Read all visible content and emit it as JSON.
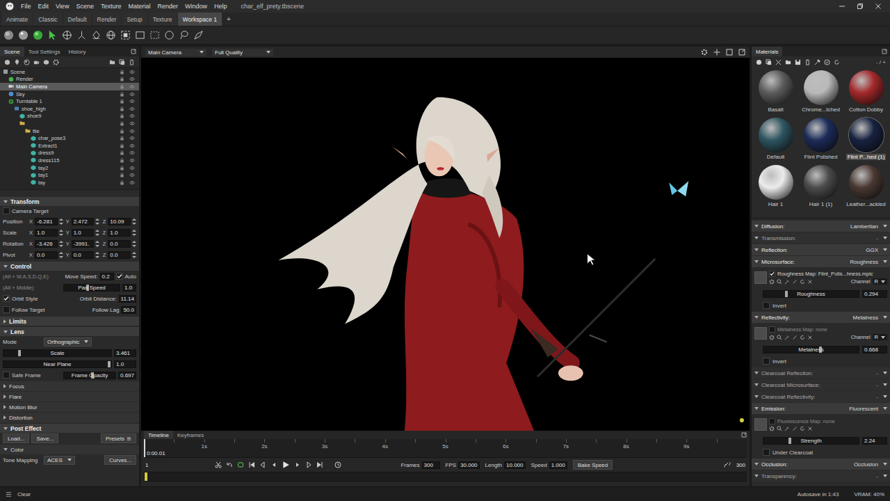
{
  "window": {
    "title": "char_elf_prety.tbscene"
  },
  "menu": [
    "File",
    "Edit",
    "View",
    "Scene",
    "Texture",
    "Material",
    "Render",
    "Window",
    "Help"
  ],
  "workspace_tabs": [
    {
      "label": "Animate",
      "selected": false
    },
    {
      "label": "Classic",
      "selected": false
    },
    {
      "label": "Default",
      "selected": false
    },
    {
      "label": "Render",
      "selected": false
    },
    {
      "label": "Setup",
      "selected": false
    },
    {
      "label": "Texture",
      "selected": false
    },
    {
      "label": "Workspace 1",
      "selected": true
    }
  ],
  "add_tab": "+",
  "left_panel": {
    "tabs": [
      {
        "label": "Scene",
        "selected": true
      },
      {
        "label": "Tool Settings",
        "selected": false
      },
      {
        "label": "History",
        "selected": false
      }
    ],
    "tree": [
      {
        "label": "Scene",
        "depth": 0,
        "kind": "scene",
        "selected": false
      },
      {
        "label": "Render",
        "depth": 1,
        "kind": "render",
        "selected": false
      },
      {
        "label": "Main Camera",
        "depth": 1,
        "kind": "camera",
        "selected": true
      },
      {
        "label": "Sky",
        "depth": 1,
        "kind": "sky",
        "selected": false
      },
      {
        "label": "Turntable 1",
        "depth": 1,
        "kind": "turntable",
        "selected": false
      },
      {
        "label": "shoe_high",
        "depth": 2,
        "kind": "group",
        "selected": false
      },
      {
        "label": "shoe9",
        "depth": 3,
        "kind": "mesh",
        "selected": false
      },
      {
        "label": "",
        "depth": 3,
        "kind": "folder",
        "selected": false
      },
      {
        "label": "file",
        "depth": 4,
        "kind": "folder",
        "selected": false
      },
      {
        "label": "char_pose3",
        "depth": 5,
        "kind": "mesh",
        "selected": false
      },
      {
        "label": "Extract1",
        "depth": 5,
        "kind": "mesh",
        "selected": false
      },
      {
        "label": "dress9",
        "depth": 5,
        "kind": "mesh",
        "selected": false
      },
      {
        "label": "dress115",
        "depth": 5,
        "kind": "mesh",
        "selected": false
      },
      {
        "label": "tay2",
        "depth": 5,
        "kind": "mesh",
        "selected": false
      },
      {
        "label": "tay1",
        "depth": 5,
        "kind": "mesh",
        "selected": false
      },
      {
        "label": "tay",
        "depth": 5,
        "kind": "mesh",
        "selected": false
      }
    ]
  },
  "transform": {
    "title": "Transform",
    "expanded": true,
    "camera_target": {
      "label": "Camera Target",
      "checked": false
    },
    "rows": [
      {
        "label": "Position",
        "values": [
          {
            "axis": "X",
            "value": "-6.281"
          },
          {
            "axis": "Y",
            "value": "2.472"
          },
          {
            "axis": "Z",
            "value": "10.09"
          }
        ]
      },
      {
        "label": "Scale",
        "values": [
          {
            "axis": "X",
            "value": "1.0"
          },
          {
            "axis": "Y",
            "value": "1.0"
          },
          {
            "axis": "Z",
            "value": "1.0"
          }
        ]
      },
      {
        "label": "Rotation",
        "values": [
          {
            "axis": "X",
            "value": "-3.426"
          },
          {
            "axis": "Y",
            "value": "-3991."
          },
          {
            "axis": "Z",
            "value": "0.0"
          }
        ]
      },
      {
        "label": "Pivot",
        "values": [
          {
            "axis": "X",
            "value": "0.0"
          },
          {
            "axis": "Y",
            "value": "0.0"
          },
          {
            "axis": "Z",
            "value": "0.0"
          }
        ]
      }
    ]
  },
  "control": {
    "title": "Control",
    "expanded": true,
    "rows": [
      {
        "left": {
          "kind": "hint",
          "text": "(Alt + W,A,S,D,Q,E)"
        },
        "right": {
          "kind": "field",
          "label": "Move Speed:",
          "value": "0.2",
          "option": {
            "label": "Auto",
            "checked": true
          }
        }
      },
      {
        "left": {
          "kind": "hint",
          "text": "(Alt + Middle)"
        },
        "right": {
          "kind": "slider",
          "label": "Pan Speed",
          "value": "1.0",
          "level": 0.43
        }
      },
      {
        "left": {
          "kind": "check",
          "label": "Orbit Style",
          "checked": true
        },
        "right": {
          "kind": "field",
          "label": "Orbit Distance:",
          "value": "11.14"
        }
      },
      {
        "left": {
          "kind": "check",
          "label": "Follow Target",
          "checked": false
        },
        "right": {
          "kind": "field",
          "label": "Follow Lag",
          "value": "50.0"
        }
      }
    ]
  },
  "limits": {
    "title": "Limits",
    "expanded": false
  },
  "lens": {
    "title": "Lens",
    "expanded": true,
    "mode": {
      "label": "Mode",
      "value": "Orthographic"
    },
    "sliders": [
      {
        "label": "Scale",
        "value": "3.461",
        "level": 0.15
      },
      {
        "label": "Near Plane",
        "value": "1.0",
        "level": 0.98
      }
    ],
    "rows": [
      {
        "left": {
          "kind": "check",
          "label": "Safe Frame",
          "checked": false
        },
        "right": {
          "kind": "slider",
          "label": "Frame Opacity",
          "value": "0.697",
          "level": 0.55
        }
      }
    ],
    "subsections": [
      {
        "title": "Focus",
        "expanded": false
      },
      {
        "title": "Flare",
        "expanded": false
      },
      {
        "title": "Motion Blur",
        "expanded": false
      },
      {
        "title": "Distortion",
        "expanded": false
      }
    ]
  },
  "post_effect": {
    "title": "Post Effect",
    "expanded": true,
    "buttons": [
      "Load...",
      "Save..."
    ],
    "presets": "Presets",
    "color": {
      "title": "Color",
      "expanded": true,
      "tone_mapping": {
        "label": "Tone Mapping",
        "value": "ACES"
      },
      "curves": "Curves..."
    }
  },
  "viewport": {
    "camera": "Main Camera",
    "quality": "Full Quality"
  },
  "timeline": {
    "tabs": [
      {
        "label": "Timeline",
        "selected": true
      },
      {
        "label": "Keyframes",
        "selected": false
      }
    ],
    "ruler": [
      "1s",
      "2s",
      "3s",
      "4s",
      "5s",
      "6s",
      "7s",
      "8s",
      "9s"
    ],
    "current_time": "0:00.01",
    "playhead": 0,
    "start_frame": "1",
    "fields": [
      {
        "label": "Frames",
        "value": "300"
      },
      {
        "label": "FPS",
        "value": "30.000"
      },
      {
        "label": "Length",
        "value": "10.000"
      },
      {
        "label": "Speed",
        "value": "1.000"
      }
    ],
    "bake_button": "Bake Speed",
    "end_frame": "300"
  },
  "materials": {
    "title": "Materials",
    "zoom": "- / +",
    "items": [
      {
        "name": "Basalt",
        "color": "#5b5b5b",
        "selected": false
      },
      {
        "name": "Chrome...tched",
        "color": "#b9b9b9",
        "selected": false
      },
      {
        "name": "Cotton Dobby",
        "color": "#a3282a",
        "selected": false
      },
      {
        "name": "Default",
        "color": "#2e5561",
        "selected": false
      },
      {
        "name": "Flint Polished",
        "color": "#1c2b58",
        "selected": false
      },
      {
        "name": "Flint P...hed (1)",
        "color": "#17223f",
        "selected": true
      },
      {
        "name": "Hair 1",
        "color": "#ececec",
        "selected": false
      },
      {
        "name": "Hair 1 (1)",
        "color": "#4b4b4b",
        "selected": false
      },
      {
        "name": "Leather...ackled",
        "color": "#4a3932",
        "selected": false
      }
    ]
  },
  "material_properties": [
    {
      "kind": "section",
      "label": "Diffusion:",
      "value": "Lambertian"
    },
    {
      "kind": "sub",
      "label": "Transmission:",
      "value": "-"
    },
    {
      "kind": "section",
      "label": "Reflection:",
      "value": "GGX"
    },
    {
      "kind": "section",
      "label": "Microsurface:",
      "value": "Roughness"
    },
    {
      "kind": "map",
      "label": "Roughness Map: Flint_Polis...hness.mpic",
      "enabled": true,
      "channel_label": "Channel",
      "channel": "R"
    },
    {
      "kind": "slider",
      "label": "Roughness",
      "value": "0.294",
      "level": 0.24
    },
    {
      "kind": "check",
      "label": "Invert",
      "checked": false
    },
    {
      "kind": "section",
      "label": "Reflectivity:",
      "value": "Metalness"
    },
    {
      "kind": "map",
      "label": "Metalness Map: none",
      "enabled": false,
      "channel_label": "Channel",
      "channel": "R"
    },
    {
      "kind": "slider",
      "label": "Metalness",
      "value": "0.668",
      "level": 0.6
    },
    {
      "kind": "check",
      "label": "Invert",
      "checked": false
    },
    {
      "kind": "sub",
      "label": "Clearcoat Reflection:",
      "value": "-"
    },
    {
      "kind": "sub",
      "label": "Clearcoat Microsurface:",
      "value": "-"
    },
    {
      "kind": "sub",
      "label": "Clearcoat Reflectivity:",
      "value": "-"
    },
    {
      "kind": "section",
      "label": "Emission:",
      "value": "Fluorescent"
    },
    {
      "kind": "map",
      "label": "Fluorescence Map: none",
      "enabled": false
    },
    {
      "kind": "slider",
      "label": "Strength",
      "value": "2.24",
      "level": 0.28
    },
    {
      "kind": "check",
      "label": "Under Clearcoat",
      "checked": false
    },
    {
      "kind": "section",
      "label": "Occlusion:",
      "value": "Occlusion"
    },
    {
      "kind": "sub",
      "label": "Transparency:",
      "value": "-"
    }
  ],
  "status_bar": {
    "left": "Clear",
    "autosave": "Autosave in 1:43",
    "vram": "VRAM: 40%"
  }
}
